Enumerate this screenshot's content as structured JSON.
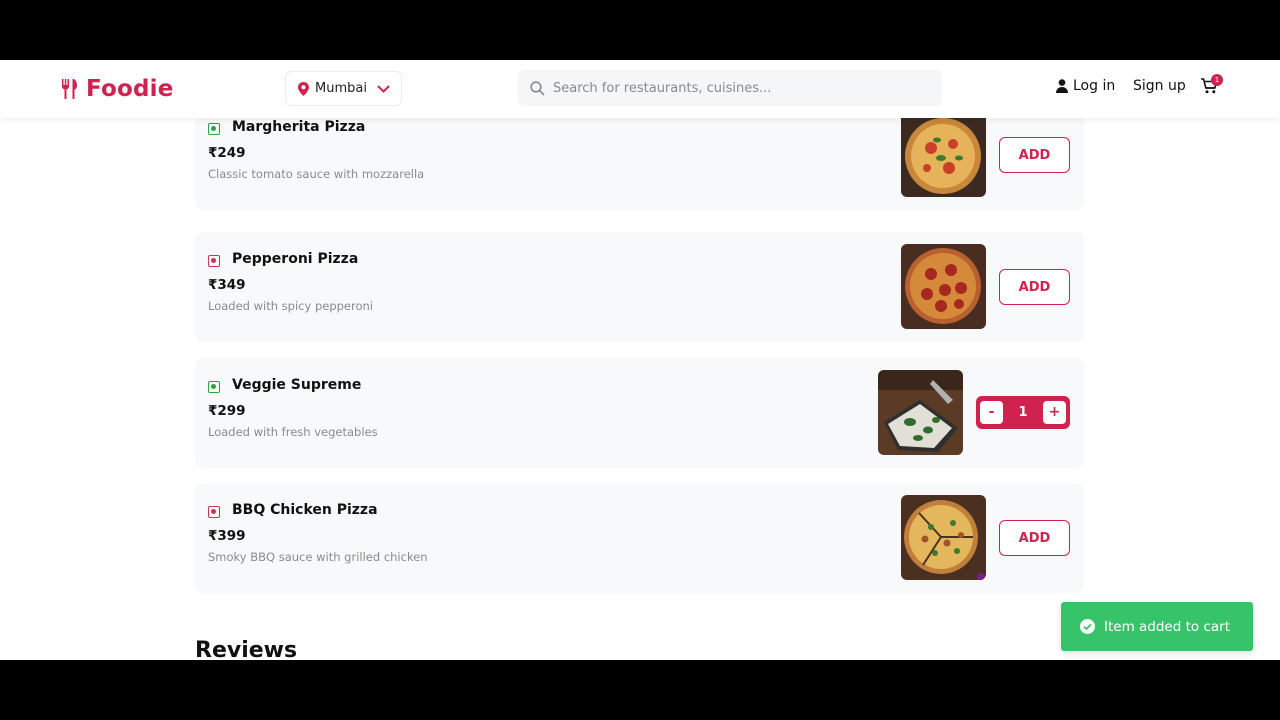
{
  "brand": {
    "name": "Foodie",
    "color": "#d0224f"
  },
  "location": {
    "city": "Mumbai",
    "icon": "map-pin-icon"
  },
  "search": {
    "placeholder": "Search for restaurants, cuisines..."
  },
  "nav": {
    "login_label": "Log in",
    "signup_label": "Sign up",
    "cart_count": "1"
  },
  "menu": {
    "items": [
      {
        "name": "Margherita Pizza",
        "price": "₹249",
        "description": "Classic tomato sauce with mozzarella",
        "veg": true,
        "action": "ADD"
      },
      {
        "name": "Pepperoni Pizza",
        "price": "₹349",
        "description": "Loaded with spicy pepperoni",
        "veg": false,
        "action": "ADD"
      },
      {
        "name": "Veggie Supreme",
        "price": "₹299",
        "description": "Loaded with fresh vegetables",
        "veg": true,
        "quantity": "1",
        "decrement": "-",
        "increment": "+"
      },
      {
        "name": "BBQ Chicken Pizza",
        "price": "₹399",
        "description": "Smoky BBQ sauce with grilled chicken",
        "veg": false,
        "action": "ADD"
      }
    ]
  },
  "reviews": {
    "heading": "Reviews"
  },
  "toast": {
    "message": "Item added to cart",
    "color": "#37c36a"
  }
}
